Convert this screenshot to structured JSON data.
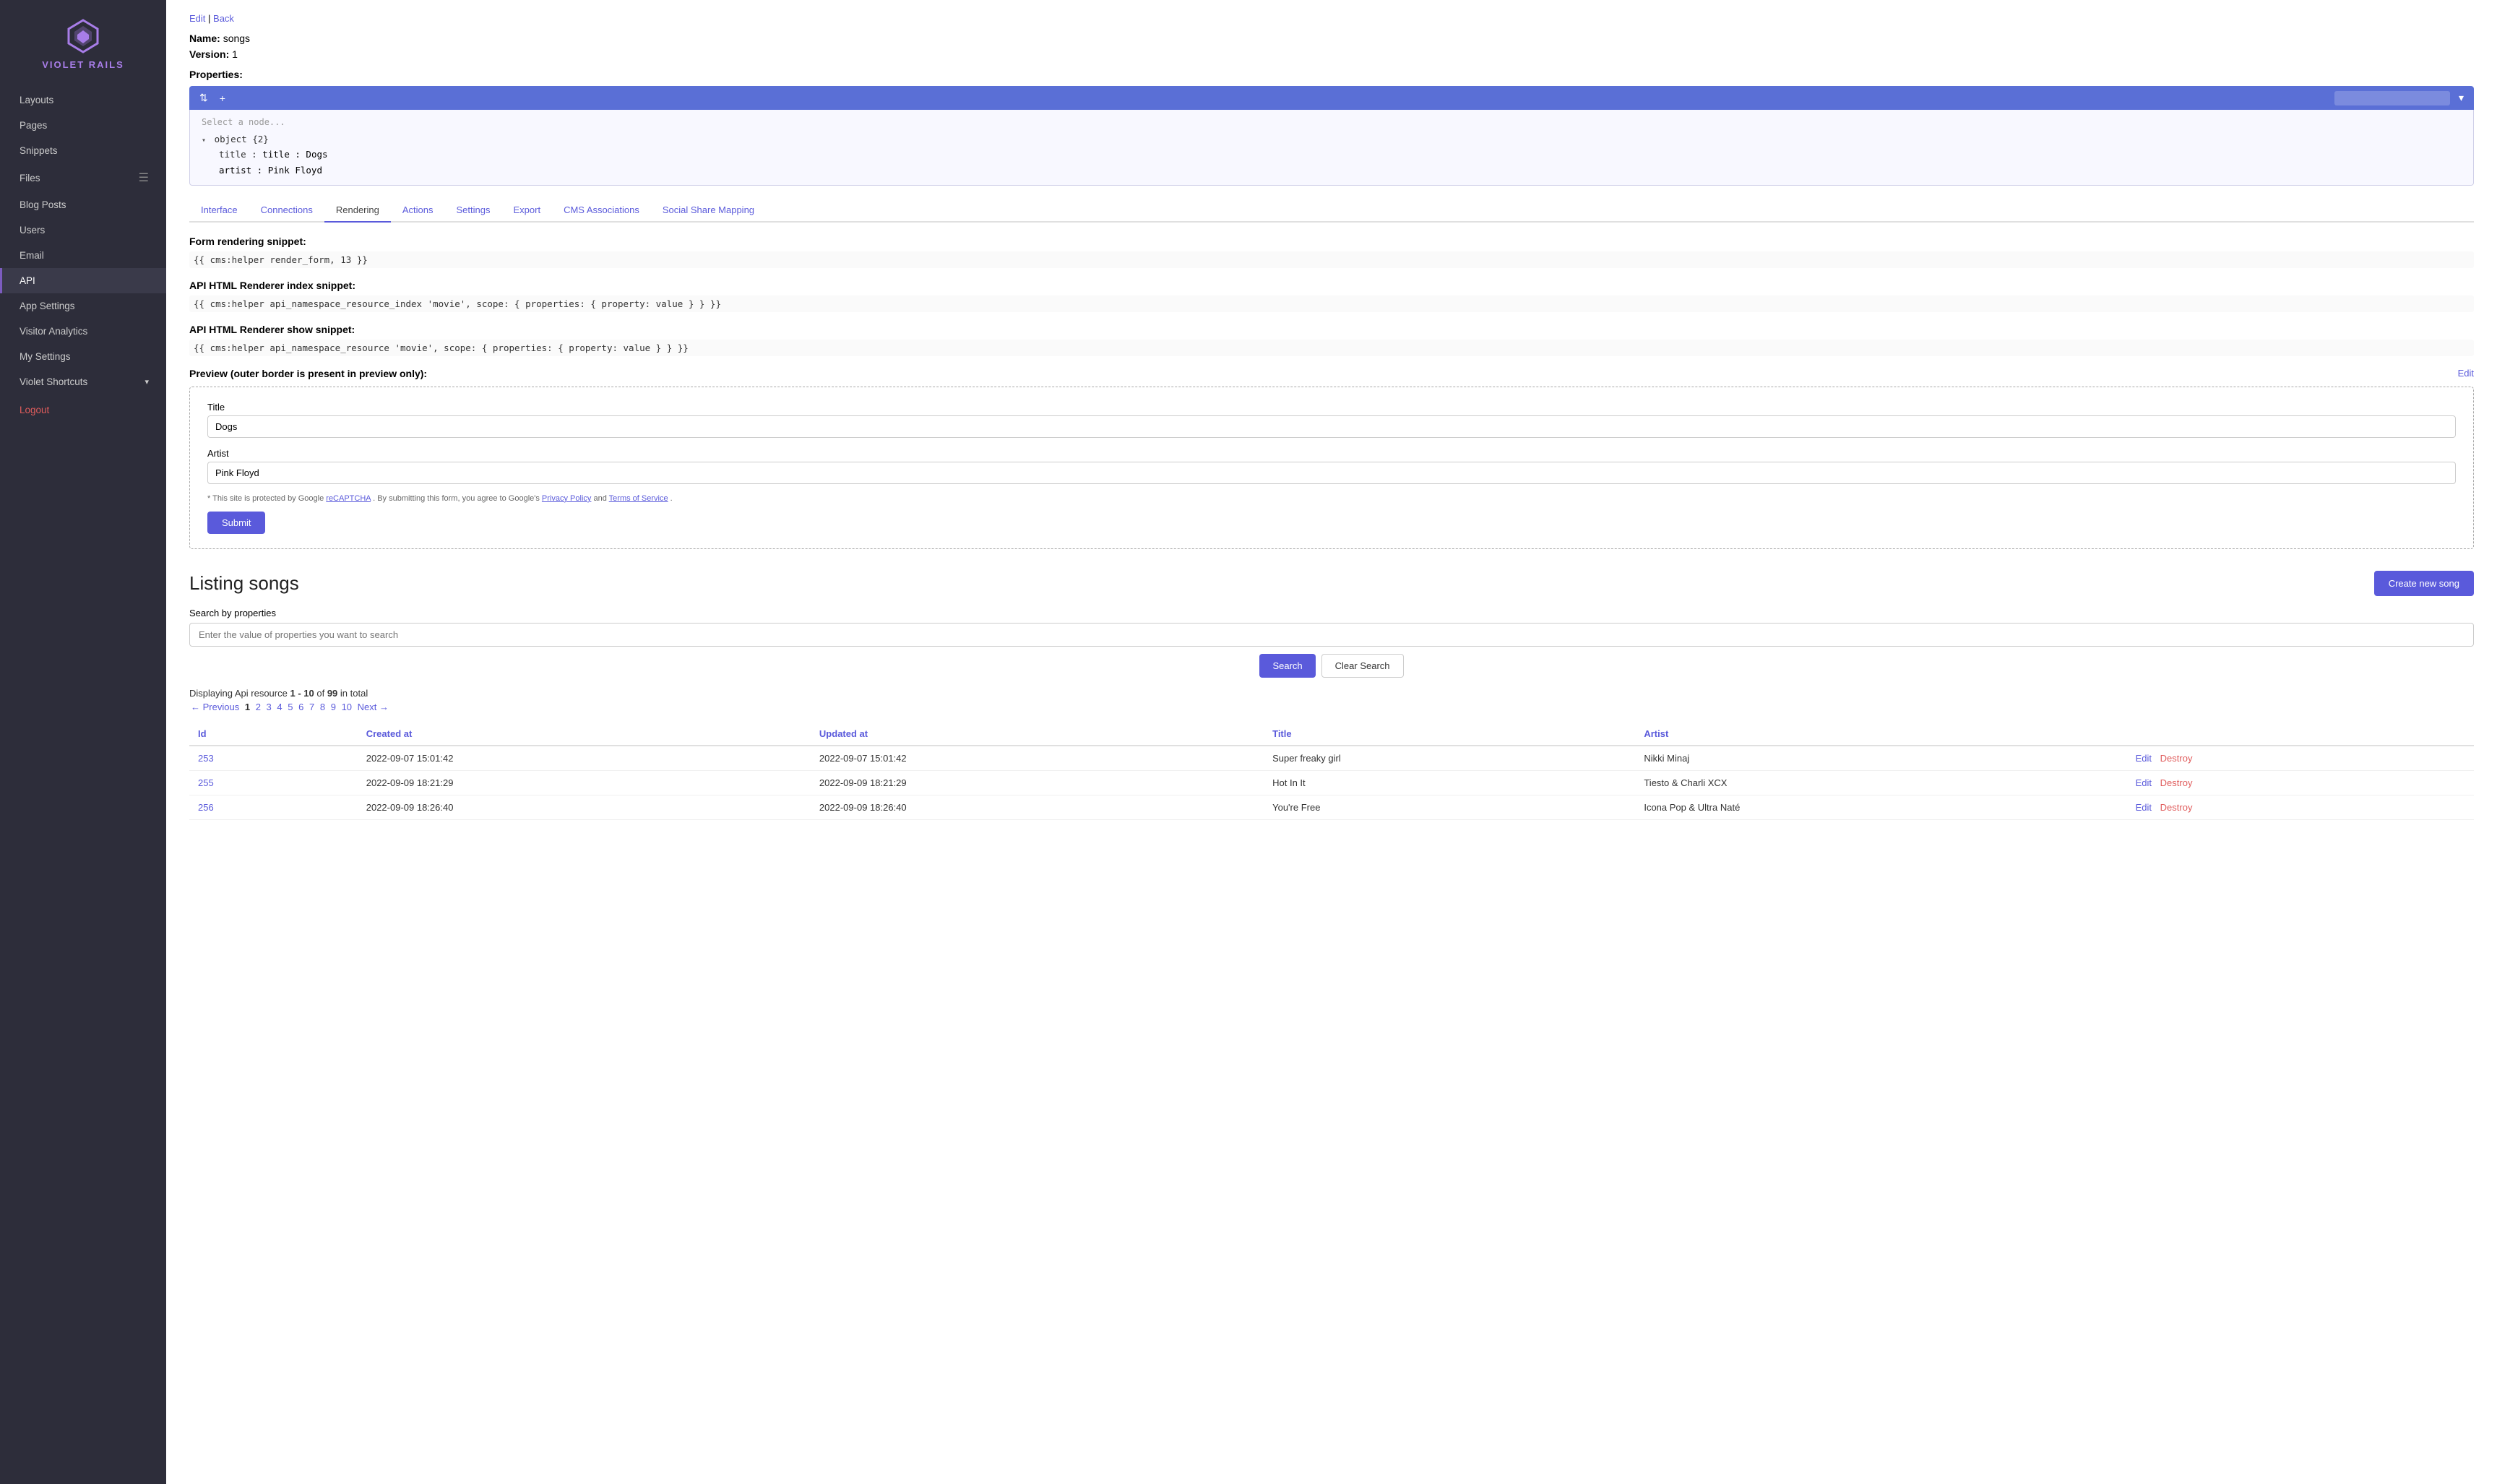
{
  "sidebar": {
    "logo_text": "VIOLET RAILS",
    "items": [
      {
        "id": "layouts",
        "label": "Layouts",
        "active": false
      },
      {
        "id": "pages",
        "label": "Pages",
        "active": false
      },
      {
        "id": "snippets",
        "label": "Snippets",
        "active": false
      },
      {
        "id": "files",
        "label": "Files",
        "active": false,
        "has_icon": true
      },
      {
        "id": "blog-posts",
        "label": "Blog Posts",
        "active": false
      },
      {
        "id": "users",
        "label": "Users",
        "active": false
      },
      {
        "id": "email",
        "label": "Email",
        "active": false
      },
      {
        "id": "api",
        "label": "API",
        "active": true
      },
      {
        "id": "app-settings",
        "label": "App Settings",
        "active": false
      },
      {
        "id": "visitor-analytics",
        "label": "Visitor Analytics",
        "active": false
      },
      {
        "id": "my-settings",
        "label": "My Settings",
        "active": false
      },
      {
        "id": "violet-shortcuts",
        "label": "Violet Shortcuts",
        "active": false,
        "has_chevron": true
      }
    ],
    "logout_label": "Logout"
  },
  "top_links": {
    "edit": "Edit",
    "back": "Back",
    "separator": "|"
  },
  "meta": {
    "name_label": "Name:",
    "name_value": "songs",
    "version_label": "Version:",
    "version_value": "1",
    "properties_label": "Properties:"
  },
  "json_editor": {
    "select_placeholder": "Select a node...",
    "object_line": "▾ object {2}",
    "title_line": "title : Dogs",
    "artist_line": "artist : Pink Floyd"
  },
  "tabs": [
    {
      "id": "interface",
      "label": "Interface",
      "active": false
    },
    {
      "id": "connections",
      "label": "Connections",
      "active": false
    },
    {
      "id": "rendering",
      "label": "Rendering",
      "active": true
    },
    {
      "id": "actions",
      "label": "Actions",
      "active": false
    },
    {
      "id": "settings",
      "label": "Settings",
      "active": false
    },
    {
      "id": "export",
      "label": "Export",
      "active": false
    },
    {
      "id": "cms-associations",
      "label": "CMS Associations",
      "active": false
    },
    {
      "id": "social-share-mapping",
      "label": "Social Share Mapping",
      "active": false
    }
  ],
  "rendering": {
    "form_snippet_label": "Form rendering snippet:",
    "form_snippet_code": "{{ cms:helper render_form, 13 }}",
    "api_index_label": "API HTML Renderer index snippet:",
    "api_index_code": "{{ cms:helper api_namespace_resource_index 'movie', scope: { properties: { property: value } } }}",
    "api_show_label": "API HTML Renderer show snippet:",
    "api_show_code": "{{ cms:helper api_namespace_resource 'movie', scope: { properties: { property: value } } }}",
    "preview_label": "Preview (outer border is present in preview only):",
    "preview_edit": "Edit",
    "form": {
      "title_label": "Title",
      "title_value": "Dogs",
      "artist_label": "Artist",
      "artist_value": "Pink Floyd",
      "recaptcha_note": "* This site is protected by Google",
      "recaptcha_link": "reCAPTCHA",
      "recaptcha_middle": ". By submitting this form, you agree to Google's",
      "privacy_link": "Privacy Policy",
      "recaptcha_and": "and",
      "terms_link": "Terms of Service",
      "recaptcha_end": ".",
      "submit_label": "Submit"
    }
  },
  "listing": {
    "title": "Listing songs",
    "create_button": "Create new song",
    "search_label": "Search by properties",
    "search_placeholder": "Enter the value of properties you want to search",
    "search_btn": "Search",
    "clear_btn": "Clear Search",
    "displaying_prefix": "Displaying Api resource",
    "displaying_range": "1 - 10",
    "displaying_of": "of",
    "displaying_total": "99",
    "displaying_suffix": "in total",
    "pagination": {
      "prev": "← Previous",
      "pages": [
        "1",
        "2",
        "3",
        "4",
        "5",
        "6",
        "7",
        "8",
        "9",
        "10"
      ],
      "next": "Next →",
      "current": "1"
    },
    "columns": [
      "Id",
      "Created at",
      "Updated at",
      "Title",
      "Artist"
    ],
    "rows": [
      {
        "id": "253",
        "created": "2022-09-07 15:01:42",
        "updated": "2022-09-07 15:01:42",
        "title": "Super freaky girl",
        "artist": "Nikki Minaj"
      },
      {
        "id": "255",
        "created": "2022-09-09 18:21:29",
        "updated": "2022-09-09 18:21:29",
        "title": "Hot In It",
        "artist": "Tiesto & Charli XCX"
      },
      {
        "id": "256",
        "created": "2022-09-09 18:26:40",
        "updated": "2022-09-09 18:26:40",
        "title": "You're Free",
        "artist": "Icona Pop & Ultra Naté"
      }
    ],
    "row_actions": {
      "edit": "Edit",
      "destroy": "Destroy"
    }
  },
  "colors": {
    "accent": "#5a5adb",
    "sidebar_bg": "#2d2d3a",
    "active_item_bg": "#3a3a4a",
    "logout": "#e05c5c",
    "logo_purple": "#a87de8"
  }
}
